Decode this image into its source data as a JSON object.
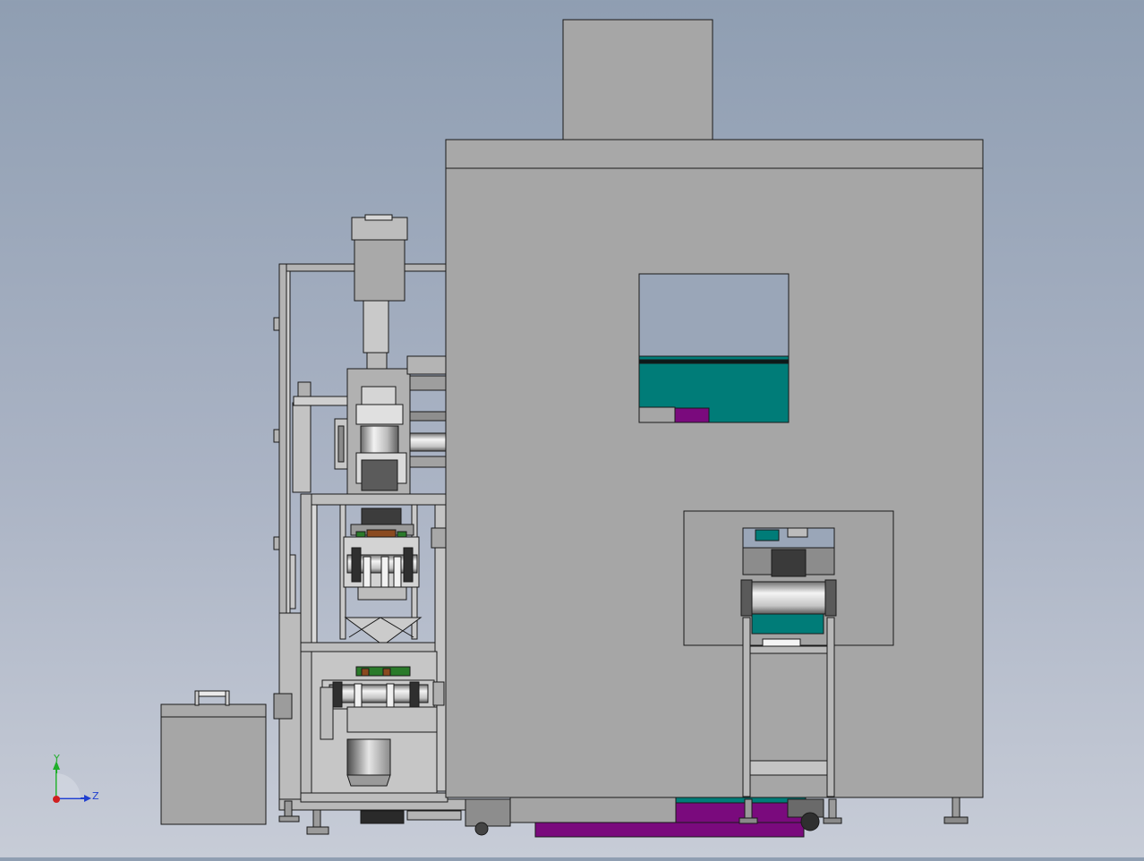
{
  "viewport": {
    "background_top": "#8f9eb2",
    "background_bottom": "#c7ccd7"
  },
  "colors": {
    "cabinet": "#a6a6a6",
    "edge": "#1a1a1a",
    "teal": "#007c78",
    "magenta": "#7a0a7d",
    "green": "#2a7a2a",
    "copper": "#8a4a20"
  },
  "triad": {
    "y_label": "Y",
    "z_label": "Z",
    "icon": "coordinate-triad-icon",
    "y_color": "#1fae2a",
    "z_color": "#1f3fd0",
    "origin_color": "#d01f1f"
  }
}
